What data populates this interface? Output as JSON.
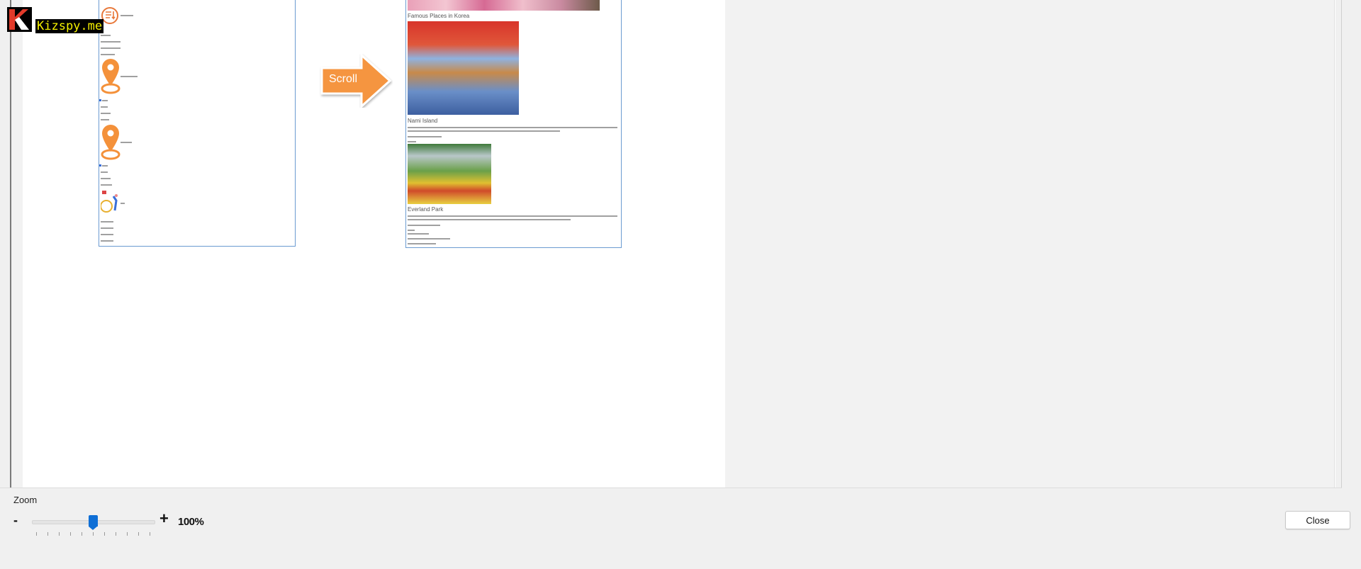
{
  "watermark": {
    "text": "Kizspy.me"
  },
  "preview": {
    "annotation_label": "Scroll",
    "right_page": {
      "section_title": "Famous Places in Korea",
      "places": [
        {
          "title": "Nami Island"
        },
        {
          "title": "Everland Park"
        }
      ]
    }
  },
  "zoom": {
    "label": "Zoom",
    "minus": "-",
    "plus": "+",
    "value_text": "100%",
    "slider_position_index": 5,
    "slider_tick_count": 11
  },
  "footer": {
    "close_label": "Close"
  },
  "colors": {
    "accent": "#0f6fd6",
    "icon_orange": "#f4913a",
    "page_border": "#6b9bd1"
  }
}
